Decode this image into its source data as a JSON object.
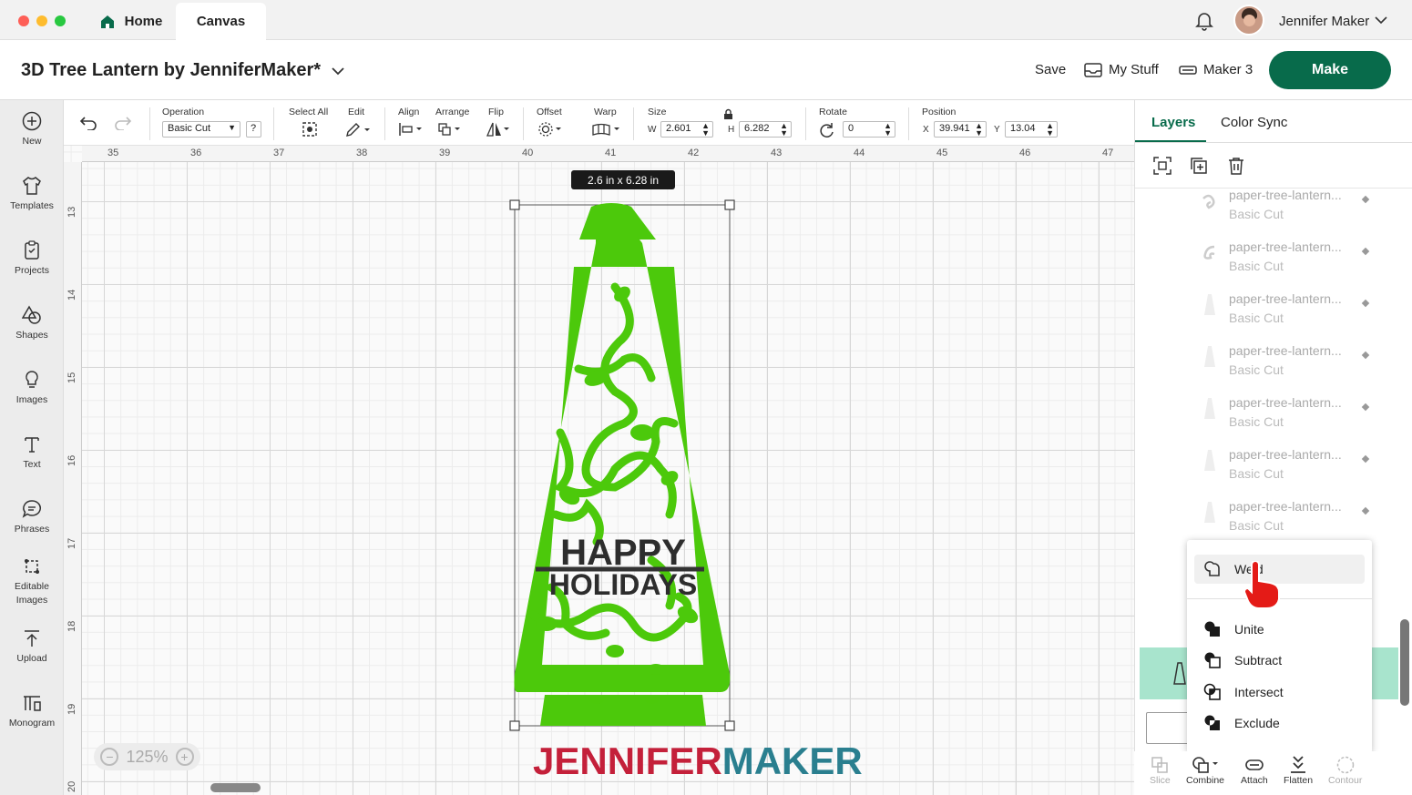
{
  "window": {
    "tabs": [
      {
        "label": "Home"
      },
      {
        "label": "Canvas"
      }
    ],
    "user": {
      "name": "Jennifer Maker"
    }
  },
  "header": {
    "project_title": "3D Tree Lantern by JenniferMaker*",
    "save_label": "Save",
    "mystuff_label": "My Stuff",
    "machine_label": "Maker 3",
    "make_label": "Make"
  },
  "sidebar": {
    "items": [
      {
        "label": "New",
        "icon": "plus-circle-icon"
      },
      {
        "label": "Templates",
        "icon": "shirt-icon"
      },
      {
        "label": "Projects",
        "icon": "clipboard-icon"
      },
      {
        "label": "Shapes",
        "icon": "shapes-icon"
      },
      {
        "label": "Images",
        "icon": "lightbulb-icon"
      },
      {
        "label": "Text",
        "icon": "text-icon"
      },
      {
        "label": "Phrases",
        "icon": "speech-bubble-icon"
      },
      {
        "label": "Editable Images",
        "icon": "editable-images-icon"
      },
      {
        "label": "Upload",
        "icon": "upload-icon"
      },
      {
        "label": "Monogram",
        "icon": "monogram-icon"
      }
    ]
  },
  "toolbar": {
    "operation_label": "Operation",
    "operation_value": "Basic Cut",
    "help": "?",
    "select_all_label": "Select All",
    "edit_label": "Edit",
    "align_label": "Align",
    "arrange_label": "Arrange",
    "flip_label": "Flip",
    "offset_label": "Offset",
    "warp_label": "Warp",
    "size_label": "Size",
    "w_label": "W",
    "w_value": "2.601",
    "h_label": "H",
    "h_value": "6.282",
    "rotate_label": "Rotate",
    "rotate_value": "0",
    "position_label": "Position",
    "x_label": "X",
    "x_value": "39.941",
    "y_label": "Y",
    "y_value": "13.04"
  },
  "canvas": {
    "ruler_top": [
      "35",
      "36",
      "37",
      "38",
      "39",
      "40",
      "41",
      "42",
      "43",
      "44",
      "45",
      "46",
      "47"
    ],
    "ruler_left": [
      "13",
      "14",
      "15",
      "16",
      "17",
      "18",
      "19",
      "20"
    ],
    "size_badge": "2.6  in x 6.28  in",
    "design_text_1": "HAPPY",
    "design_text_2": "HOLIDAYS",
    "zoom": "125%",
    "watermark_a": "JENNIFER",
    "watermark_b": "MAKER"
  },
  "panel": {
    "tab_layers": "Layers",
    "tab_color_sync": "Color Sync",
    "layers": [
      {
        "name": "paper-tree-lantern...",
        "type": "Basic Cut"
      },
      {
        "name": "paper-tree-lantern...",
        "type": "Basic Cut"
      },
      {
        "name": "paper-tree-lantern...",
        "type": "Basic Cut"
      },
      {
        "name": "paper-tree-lantern...",
        "type": "Basic Cut"
      },
      {
        "name": "paper-tree-lantern...",
        "type": "Basic Cut"
      },
      {
        "name": "paper-tree-lantern...",
        "type": "Basic Cut"
      },
      {
        "name": "paper-tree-lantern...",
        "type": "Basic Cut"
      }
    ],
    "combine_menu": [
      {
        "label": "Weld"
      },
      {
        "label": "Unite"
      },
      {
        "label": "Subtract"
      },
      {
        "label": "Intersect"
      },
      {
        "label": "Exclude"
      }
    ],
    "bottom_tools": [
      {
        "label": "Slice"
      },
      {
        "label": "Combine"
      },
      {
        "label": "Attach"
      },
      {
        "label": "Flatten"
      },
      {
        "label": "Contour"
      }
    ]
  },
  "colors": {
    "brand_green": "#086b4b",
    "design_green": "#4cc90b",
    "selected_layer": "#a8e4cd",
    "watermark_red": "#c4203a",
    "watermark_teal": "#2a7f8f"
  }
}
